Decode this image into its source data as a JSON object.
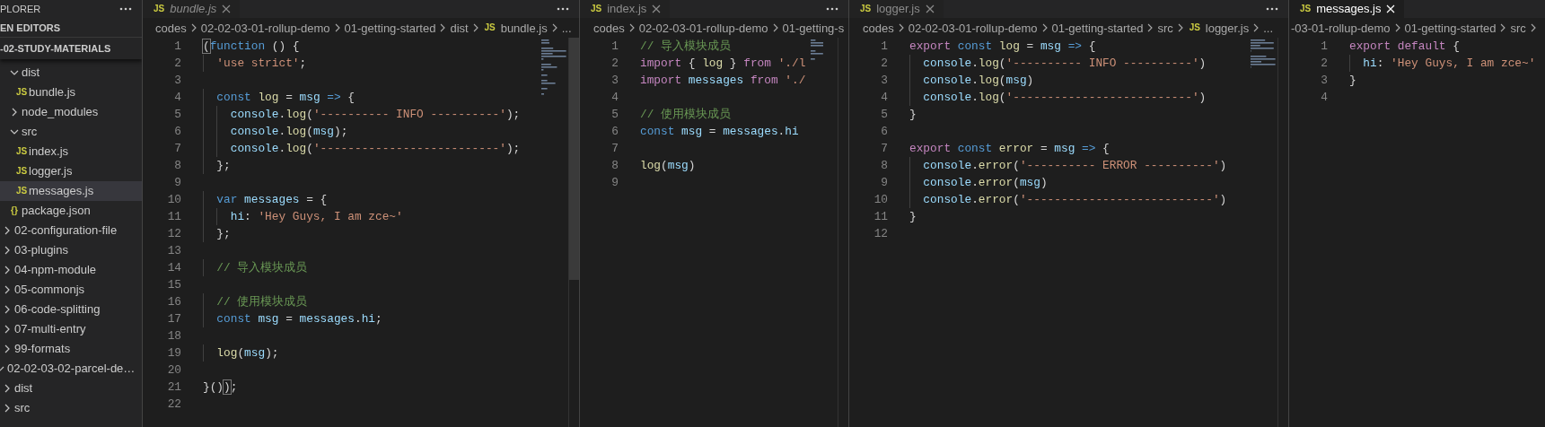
{
  "sidebar": {
    "title": "PLORER",
    "actions_menu": true,
    "open_editors": "EN EDITORS",
    "folder": "-02-STUDY-MATERIALS",
    "tree": [
      {
        "children": [
          {
            "children": [
              {
                "label": "dist",
                "kind": "folder",
                "expanded": true,
                "selected": false,
                "children": [
                  {
                    "label": "bundle.js",
                    "kind": "file",
                    "icon_text": "JS",
                    "selected": false
                  }
                ]
              },
              {
                "label": "node_modules",
                "kind": "folder",
                "expanded": false,
                "selected": false
              },
              {
                "label": "src",
                "kind": "folder",
                "expanded": true,
                "selected": false,
                "children": [
                  {
                    "label": "index.js",
                    "kind": "file",
                    "icon_text": "JS",
                    "selected": false
                  },
                  {
                    "label": "logger.js",
                    "kind": "file",
                    "icon_text": "JS",
                    "selected": false
                  },
                  {
                    "label": "messages.js",
                    "kind": "file",
                    "icon_text": "JS",
                    "selected": true
                  }
                ]
              },
              {
                "label": "package.json",
                "kind": "file",
                "icon_text": "{}",
                "selected": false
              }
            ]
          },
          {
            "label": "02-configuration-file",
            "kind": "folder",
            "expanded": false,
            "selected": false
          },
          {
            "label": "03-plugins",
            "kind": "folder",
            "expanded": false,
            "selected": false
          },
          {
            "label": "04-npm-module",
            "kind": "folder",
            "expanded": false,
            "selected": false
          },
          {
            "label": "05-commonjs",
            "kind": "folder",
            "expanded": false,
            "selected": false
          },
          {
            "label": "06-code-splitting",
            "kind": "folder",
            "expanded": false,
            "selected": false
          },
          {
            "label": "07-multi-entry",
            "kind": "folder",
            "expanded": false,
            "selected": false
          },
          {
            "label": "99-formats",
            "kind": "folder",
            "expanded": false,
            "selected": false
          }
        ]
      },
      {
        "label": "02-02-03-02-parcel-de…",
        "kind": "folder",
        "expanded": true,
        "selected": false,
        "children": [
          {
            "label": "dist",
            "kind": "folder",
            "expanded": false,
            "selected": false
          },
          {
            "label": "src",
            "kind": "folder",
            "expanded": false,
            "selected": false
          }
        ]
      }
    ]
  },
  "editors": [
    {
      "tab": {
        "icon_text": "JS",
        "label": "bundle.js",
        "preview": true,
        "focused": false
      },
      "actions_menu": true,
      "minimap": true,
      "scrollbar": true,
      "trailing_separator": false,
      "breadcrumbs": [
        {
          "text": "codes"
        },
        {
          "text": "02-02-03-01-rollup-demo"
        },
        {
          "text": "01-getting-started"
        },
        {
          "text": "dist"
        },
        {
          "text": "bundle.js",
          "icon_text": "JS"
        },
        {
          "text": "..."
        }
      ],
      "lines": [
        {
          "number": "1",
          "tokens": [
            {
              "kind": "match",
              "text": "("
            },
            {
              "kind": "kw",
              "text": "function"
            },
            {
              "kind": "p",
              "text": " () {"
            }
          ]
        },
        {
          "number": "2",
          "tokens": [
            {
              "kind": "str",
              "text": "  'use strict'"
            },
            {
              "kind": "p",
              "text": ";"
            }
          ]
        },
        {
          "number": "3"
        },
        {
          "number": "4",
          "tokens": [
            {
              "kind": "kw",
              "text": "  const "
            },
            {
              "kind": "fn",
              "text": "log"
            },
            {
              "kind": "p",
              "text": " = "
            },
            {
              "kind": "var",
              "text": "msg"
            },
            {
              "kind": "kw",
              "text": " =>"
            },
            {
              "kind": "p",
              "text": " {"
            }
          ]
        },
        {
          "number": "5",
          "tokens": [
            {
              "kind": "var",
              "text": "    console"
            },
            {
              "kind": "p",
              "text": "."
            },
            {
              "kind": "fn",
              "text": "log"
            },
            {
              "kind": "p",
              "text": "("
            },
            {
              "kind": "str",
              "text": "'---------- INFO ----------'"
            },
            {
              "kind": "p",
              "text": ");"
            }
          ]
        },
        {
          "number": "6",
          "tokens": [
            {
              "kind": "var",
              "text": "    console"
            },
            {
              "kind": "p",
              "text": "."
            },
            {
              "kind": "fn",
              "text": "log"
            },
            {
              "kind": "p",
              "text": "("
            },
            {
              "kind": "var",
              "text": "msg"
            },
            {
              "kind": "p",
              "text": ");"
            }
          ]
        },
        {
          "number": "7",
          "tokens": [
            {
              "kind": "var",
              "text": "    console"
            },
            {
              "kind": "p",
              "text": "."
            },
            {
              "kind": "fn",
              "text": "log"
            },
            {
              "kind": "p",
              "text": "("
            },
            {
              "kind": "str",
              "text": "'--------------------------'"
            },
            {
              "kind": "p",
              "text": ");"
            }
          ]
        },
        {
          "number": "8",
          "tokens": [
            {
              "kind": "p",
              "text": "  };"
            }
          ]
        },
        {
          "number": "9"
        },
        {
          "number": "10",
          "tokens": [
            {
              "kind": "kw",
              "text": "  var "
            },
            {
              "kind": "var",
              "text": "messages"
            },
            {
              "kind": "p",
              "text": " = {"
            }
          ]
        },
        {
          "number": "11",
          "tokens": [
            {
              "kind": "var",
              "text": "    hi"
            },
            {
              "kind": "p",
              "text": ": "
            },
            {
              "kind": "str",
              "text": "'Hey Guys, I am zce~'"
            }
          ]
        },
        {
          "number": "12",
          "tokens": [
            {
              "kind": "p",
              "text": "  };"
            }
          ]
        },
        {
          "number": "13"
        },
        {
          "number": "14",
          "tokens": [
            {
              "kind": "comment",
              "text": "  // 导入模块成员"
            }
          ]
        },
        {
          "number": "15"
        },
        {
          "number": "16",
          "tokens": [
            {
              "kind": "comment",
              "text": "  // 使用模块成员"
            }
          ]
        },
        {
          "number": "17",
          "tokens": [
            {
              "kind": "kw",
              "text": "  const "
            },
            {
              "kind": "var",
              "text": "msg"
            },
            {
              "kind": "p",
              "text": " = "
            },
            {
              "kind": "var",
              "text": "messages"
            },
            {
              "kind": "p",
              "text": "."
            },
            {
              "kind": "var",
              "text": "hi"
            },
            {
              "kind": "p",
              "text": ";"
            }
          ]
        },
        {
          "number": "18"
        },
        {
          "number": "19",
          "tokens": [
            {
              "kind": "fn",
              "text": "  log"
            },
            {
              "kind": "p",
              "text": "("
            },
            {
              "kind": "var",
              "text": "msg"
            },
            {
              "kind": "p",
              "text": ");"
            }
          ]
        },
        {
          "number": "20"
        },
        {
          "number": "21",
          "tokens": [
            {
              "kind": "p",
              "text": "}()"
            },
            {
              "kind": "match",
              "text": ")"
            },
            {
              "kind": "p",
              "text": ";"
            }
          ]
        },
        {
          "number": "22"
        }
      ]
    },
    {
      "tab": {
        "icon_text": "JS",
        "label": "index.js",
        "preview": false,
        "focused": false
      },
      "actions_menu": true,
      "minimap": true,
      "scrollbar": false,
      "trailing_separator": false,
      "breadcrumbs": [
        {
          "text": "codes"
        },
        {
          "text": "02-02-03-01-rollup-demo"
        },
        {
          "text": "01-getting-s"
        }
      ],
      "lines": [
        {
          "number": "1",
          "tokens": [
            {
              "kind": "comment",
              "text": "// 导入模块成员"
            }
          ]
        },
        {
          "number": "2",
          "tokens": [
            {
              "kind": "ctrl",
              "text": "import"
            },
            {
              "kind": "p",
              "text": " { "
            },
            {
              "kind": "fn",
              "text": "log"
            },
            {
              "kind": "p",
              "text": " } "
            },
            {
              "kind": "ctrl",
              "text": "from "
            },
            {
              "kind": "str",
              "text": "'./l"
            }
          ]
        },
        {
          "number": "3",
          "tokens": [
            {
              "kind": "ctrl",
              "text": "import "
            },
            {
              "kind": "var",
              "text": "messages "
            },
            {
              "kind": "ctrl",
              "text": "from "
            },
            {
              "kind": "str",
              "text": "'./"
            }
          ]
        },
        {
          "number": "4"
        },
        {
          "number": "5",
          "tokens": [
            {
              "kind": "comment",
              "text": "// 使用模块成员"
            }
          ]
        },
        {
          "number": "6",
          "tokens": [
            {
              "kind": "kw",
              "text": "const "
            },
            {
              "kind": "var",
              "text": "msg"
            },
            {
              "kind": "p",
              "text": " = "
            },
            {
              "kind": "var",
              "text": "messages"
            },
            {
              "kind": "p",
              "text": "."
            },
            {
              "kind": "var",
              "text": "hi"
            }
          ]
        },
        {
          "number": "7"
        },
        {
          "number": "8",
          "tokens": [
            {
              "kind": "fn",
              "text": "log"
            },
            {
              "kind": "p",
              "text": "("
            },
            {
              "kind": "var",
              "text": "msg"
            },
            {
              "kind": "p",
              "text": ")"
            }
          ]
        },
        {
          "number": "9"
        }
      ]
    },
    {
      "tab": {
        "icon_text": "JS",
        "label": "logger.js",
        "preview": false,
        "focused": false
      },
      "actions_menu": true,
      "minimap": true,
      "scrollbar": false,
      "trailing_separator": false,
      "breadcrumbs": [
        {
          "text": "codes"
        },
        {
          "text": "02-02-03-01-rollup-demo"
        },
        {
          "text": "01-getting-started"
        },
        {
          "text": "src"
        },
        {
          "text": "logger.js",
          "icon_text": "JS"
        },
        {
          "text": "..."
        }
      ],
      "lines": [
        {
          "number": "1",
          "tokens": [
            {
              "kind": "ctrl",
              "text": "export "
            },
            {
              "kind": "kw",
              "text": "const "
            },
            {
              "kind": "fn",
              "text": "log"
            },
            {
              "kind": "p",
              "text": " = "
            },
            {
              "kind": "var",
              "text": "msg"
            },
            {
              "kind": "kw",
              "text": " =>"
            },
            {
              "kind": "p",
              "text": " {"
            }
          ]
        },
        {
          "number": "2",
          "tokens": [
            {
              "kind": "var",
              "text": "  console"
            },
            {
              "kind": "p",
              "text": "."
            },
            {
              "kind": "fn",
              "text": "log"
            },
            {
              "kind": "p",
              "text": "("
            },
            {
              "kind": "str",
              "text": "'---------- INFO ----------'"
            },
            {
              "kind": "p",
              "text": ")"
            }
          ]
        },
        {
          "number": "3",
          "tokens": [
            {
              "kind": "var",
              "text": "  console"
            },
            {
              "kind": "p",
              "text": "."
            },
            {
              "kind": "fn",
              "text": "log"
            },
            {
              "kind": "p",
              "text": "("
            },
            {
              "kind": "var",
              "text": "msg"
            },
            {
              "kind": "p",
              "text": ")"
            }
          ]
        },
        {
          "number": "4",
          "tokens": [
            {
              "kind": "var",
              "text": "  console"
            },
            {
              "kind": "p",
              "text": "."
            },
            {
              "kind": "fn",
              "text": "log"
            },
            {
              "kind": "p",
              "text": "("
            },
            {
              "kind": "str",
              "text": "'--------------------------'"
            },
            {
              "kind": "p",
              "text": ")"
            }
          ]
        },
        {
          "number": "5",
          "tokens": [
            {
              "kind": "p",
              "text": "}"
            }
          ]
        },
        {
          "number": "6"
        },
        {
          "number": "7",
          "tokens": [
            {
              "kind": "ctrl",
              "text": "export "
            },
            {
              "kind": "kw",
              "text": "const "
            },
            {
              "kind": "fn",
              "text": "error"
            },
            {
              "kind": "p",
              "text": " = "
            },
            {
              "kind": "var",
              "text": "msg"
            },
            {
              "kind": "kw",
              "text": " =>"
            },
            {
              "kind": "p",
              "text": " {"
            }
          ]
        },
        {
          "number": "8",
          "tokens": [
            {
              "kind": "var",
              "text": "  console"
            },
            {
              "kind": "p",
              "text": "."
            },
            {
              "kind": "fn",
              "text": "error"
            },
            {
              "kind": "p",
              "text": "("
            },
            {
              "kind": "str",
              "text": "'---------- ERROR ----------'"
            },
            {
              "kind": "p",
              "text": ")"
            }
          ]
        },
        {
          "number": "9",
          "tokens": [
            {
              "kind": "var",
              "text": "  console"
            },
            {
              "kind": "p",
              "text": "."
            },
            {
              "kind": "fn",
              "text": "error"
            },
            {
              "kind": "p",
              "text": "("
            },
            {
              "kind": "var",
              "text": "msg"
            },
            {
              "kind": "p",
              "text": ")"
            }
          ]
        },
        {
          "number": "10",
          "tokens": [
            {
              "kind": "var",
              "text": "  console"
            },
            {
              "kind": "p",
              "text": "."
            },
            {
              "kind": "fn",
              "text": "error"
            },
            {
              "kind": "p",
              "text": "("
            },
            {
              "kind": "str",
              "text": "'---------------------------'"
            },
            {
              "kind": "p",
              "text": ")"
            }
          ]
        },
        {
          "number": "11",
          "tokens": [
            {
              "kind": "p",
              "text": "}"
            }
          ]
        },
        {
          "number": "12"
        }
      ]
    },
    {
      "tab": {
        "icon_text": "JS",
        "label": "messages.js",
        "preview": false,
        "focused": true
      },
      "actions_menu": false,
      "minimap": false,
      "scrollbar": false,
      "trailing_separator": true,
      "breadcrumbs": [
        {
          "text": "-03-01-rollup-demo"
        },
        {
          "text": "01-getting-started"
        },
        {
          "text": "src"
        }
      ],
      "lines": [
        {
          "number": "1",
          "tokens": [
            {
              "kind": "ctrl",
              "text": "export default "
            },
            {
              "kind": "p",
              "text": "{"
            }
          ]
        },
        {
          "number": "2",
          "tokens": [
            {
              "kind": "var",
              "text": "  hi"
            },
            {
              "kind": "p",
              "text": ": "
            },
            {
              "kind": "str",
              "text": "'Hey Guys, I am zce~'"
            }
          ]
        },
        {
          "number": "3",
          "tokens": [
            {
              "kind": "p",
              "text": "}"
            }
          ]
        },
        {
          "number": "4"
        }
      ]
    }
  ]
}
